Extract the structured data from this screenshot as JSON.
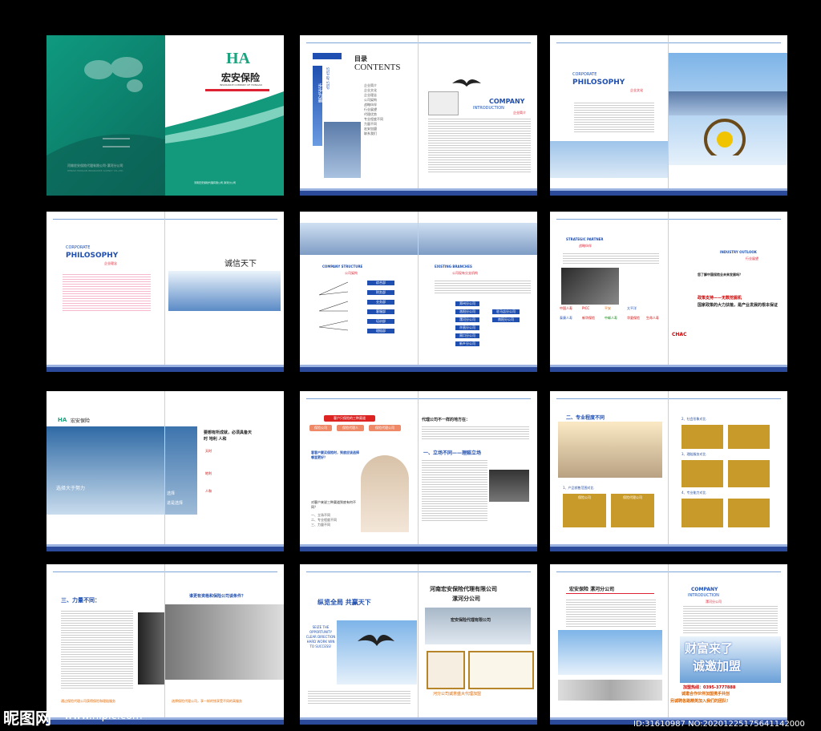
{
  "cover": {
    "logo_letters": "HA",
    "brand_cn": "宏安保险",
    "brand_en": "INSURANCE COMPANY OF HONGAN",
    "company_cn": "河南宏安保险代理有限公司·漯河分公司",
    "company_en": "HENAN HONGAN INSURANCE AGENCY CO.,LTD",
    "footer_cn": "河南宏安保险代理有限公司·漯河分公司"
  },
  "contents": {
    "title_cn": "目录",
    "title_en": "CONTENTS",
    "vertical_en": "STEP BY STEP",
    "vertical_cn": "步步为赢",
    "intro_en": "COMPANY",
    "intro_en2": "INTRODUCTION",
    "intro_cn": "企业简介",
    "items": [
      "企业简介",
      "企业文化",
      "企业理念",
      "公司架构",
      "战略伙伴",
      "行业展望",
      "代理优势",
      "专业程度不同",
      "力量不同",
      "宏安加盟",
      "联系我们"
    ]
  },
  "philosophy": {
    "corporate": "CORPORATE",
    "title": "PHILOSOPHY",
    "culture_cn": "企业文化",
    "concept_cn": "企业理念",
    "calligraphy": "诚信天下"
  },
  "structure": {
    "label_en": "COMPANY STRUCTURE",
    "label_cn": "公司架构",
    "branches_en": "EXISTING BRANCHES",
    "branches_cn": "公司现有分支机构",
    "left_items": [
      "综合部",
      "财务部",
      "业务部",
      "客服部",
      "培训部",
      "理赔部"
    ],
    "right_items": [
      "郑州分公司",
      "洛阳分公司",
      "漯河分公司",
      "许昌分公司",
      "周口分公司",
      "新乡分公司"
    ],
    "right_items2": [
      "驻马店分公司",
      "南阳分公司"
    ]
  },
  "strategic": {
    "label_en": "STRATEGIC PARTNER",
    "label_cn": "战略伙伴",
    "outlook_en": "INDUSTRY OUTLOOK",
    "outlook_cn": "行业展望",
    "question": "您了解中国保险业未来发展吗？",
    "policy": "政策支持——无数挖掘机",
    "policy2": "国家政策的大力扶植，是产业发展的根本保证",
    "partners": [
      "中国人寿",
      "PICC",
      "平安",
      "太平洋",
      "泰康人寿",
      "新华保险",
      "CHAC",
      "诚泰保险",
      "中国人保",
      "中邮人寿",
      "华夏保险",
      "生命人寿"
    ]
  },
  "success": {
    "headline": "要想有所成就，必须具备天时 地利 人和",
    "sub1": "天时",
    "sub2": "地利",
    "sub3": "人和",
    "slogan1": "选择大于努力",
    "slogan2": "选择",
    "slogan3": "进是选择"
  },
  "advantage": {
    "tag": "客户只保险的三种渠道",
    "boxes": [
      "保险公司",
      "保险代理人",
      "保险代理公司"
    ],
    "question": "客客户要买保险时，到底应该选择哪里更好？",
    "title": "代理公司不一样的地方在：",
    "section": "一、立场不同——理赔立场",
    "ask": "对客户来说三种渠道到底有何不同？",
    "list": [
      "一、立场不同",
      "二、专业程度不同",
      "三、力量不同"
    ]
  },
  "professional": {
    "title": "二、专业程度不同",
    "col1": "1、产品销售范围对比",
    "col2": "2、社会形象对比",
    "col3": "3、理赔服务对比",
    "col4": "4、专业能力对比",
    "labels": [
      "保险公司",
      "保险代理公司"
    ]
  },
  "power": {
    "title": "三、力量不同：",
    "qualification": "谁更有资格和保险公司谈条件？",
    "footer1": "通过保险代理公司获得保险和理赔服务",
    "footer2": "选择保险代理公司，享一样的钱享受不同的高服务"
  },
  "join": {
    "slogan": "纵览全局 共赢天下",
    "slogan_en": "SEIZE THE OPPORTUNITY CLEAR DIRECTION HARD WORK WIN TO SUCCESS!",
    "company": "河南宏安保险代理有限公司",
    "branch": "漯河分公司",
    "sign": "宏安保险代理有限公司",
    "brand_head": "宏安保险 漯河分公司",
    "big1": "财富来了",
    "big2": "诚邀加盟",
    "phone_label": "加盟热线：",
    "phone": "0395-3777888",
    "recruit": "诚邀合作伙伴加盟携手共创",
    "recruit2": "另诚聘各路精英加入我们的团队!",
    "intro_en": "COMPANY",
    "intro_en2": "INTRODUCTION",
    "intro_cn": "漯河分公司",
    "footer_ad": "河分公司诚意盛大代理加盟"
  },
  "watermark": {
    "logo": "昵图网",
    "url": "www.nipic.com",
    "id": "ID:31610987 NO:20201225175641142000"
  }
}
